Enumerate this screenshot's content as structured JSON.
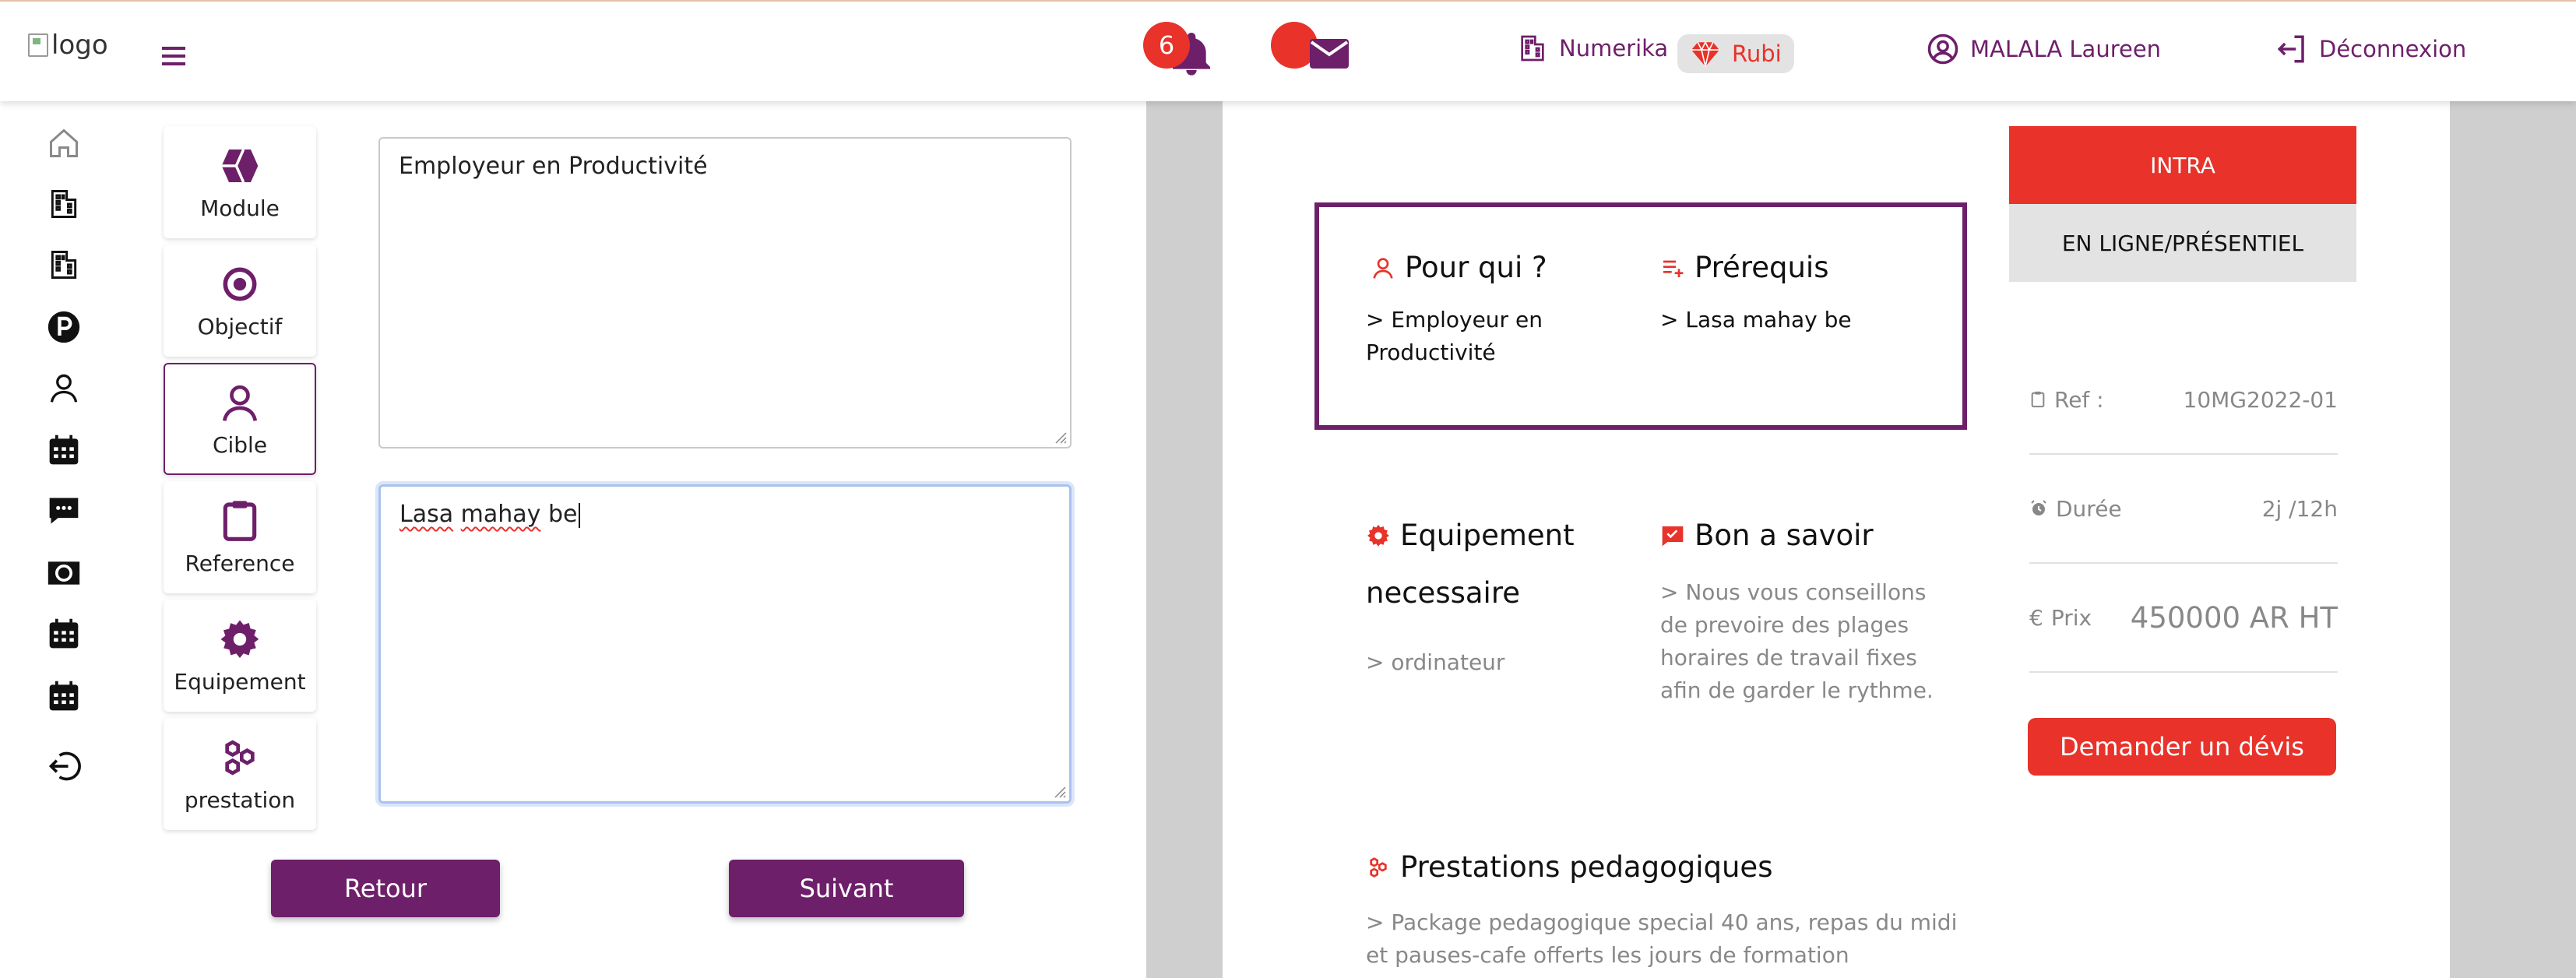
{
  "header": {
    "logo_alt": "logo",
    "notifications_count": "6",
    "links": {
      "numerika": "Numerika",
      "rubi": "Rubi",
      "user": "MALALA Laureen",
      "logout": "Déconnexion"
    }
  },
  "sidebar": {
    "icons": [
      "home-icon",
      "building-icon",
      "building-icon",
      "parking-icon",
      "user-icon",
      "calendar-icon",
      "chat-icon",
      "money-icon",
      "calendar-icon",
      "calendar-icon",
      "logout-icon"
    ]
  },
  "form": {
    "tabs": [
      {
        "label": "Module",
        "icon": "cube-icon"
      },
      {
        "label": "Objectif",
        "icon": "target-icon"
      },
      {
        "label": "Cible",
        "icon": "user-icon"
      },
      {
        "label": "Reference",
        "icon": "clipboard-icon"
      },
      {
        "label": "Equipement",
        "icon": "gear-icon"
      },
      {
        "label": "prestation",
        "icon": "hexagons-icon"
      }
    ],
    "active_tab": "Cible",
    "field1_value": "Employeur en Productivité",
    "field2_value_word1": "Lasa",
    "field2_value_word2": "mahay",
    "field2_value_word3": "be",
    "back_label": "Retour",
    "next_label": "Suivant"
  },
  "preview": {
    "pour_qui": {
      "title": "Pour qui ?",
      "line1": "> Employeur en",
      "line2": "Productivité"
    },
    "prerequis": {
      "title": "Prérequis",
      "text": "> Lasa mahay be"
    },
    "equipement": {
      "title_line1": "Equipement",
      "title_line2": "necessaire",
      "text": "> ordinateur"
    },
    "bon_a_savoir": {
      "title": "Bon a savoir",
      "lines": [
        "> Nous vous conseillons",
        "de prevoire des plages",
        "horaires de travail fixes",
        "afin de garder le rythme."
      ]
    },
    "prestations": {
      "title": "Prestations pedagogiques",
      "line1": "> Package pedagogique special 40 ans, repas du midi",
      "line2": "et pauses-cafe offerts les jours de formation"
    },
    "intra_label": "INTRA",
    "mode_label": "EN LIGNE/PRÉSENTIEL",
    "ref": {
      "label": "Ref :",
      "value": "10MG2022-01"
    },
    "duree": {
      "label": "Durée",
      "value": "2j /12h"
    },
    "prix": {
      "currency": "€",
      "label": "Prix",
      "value": "450000 AR HT"
    },
    "devis_label": "Demander un dévis"
  },
  "colors": {
    "primary": "#6e1f6a",
    "accent": "#e8322a",
    "preview_bg": "#cfcfcf"
  }
}
